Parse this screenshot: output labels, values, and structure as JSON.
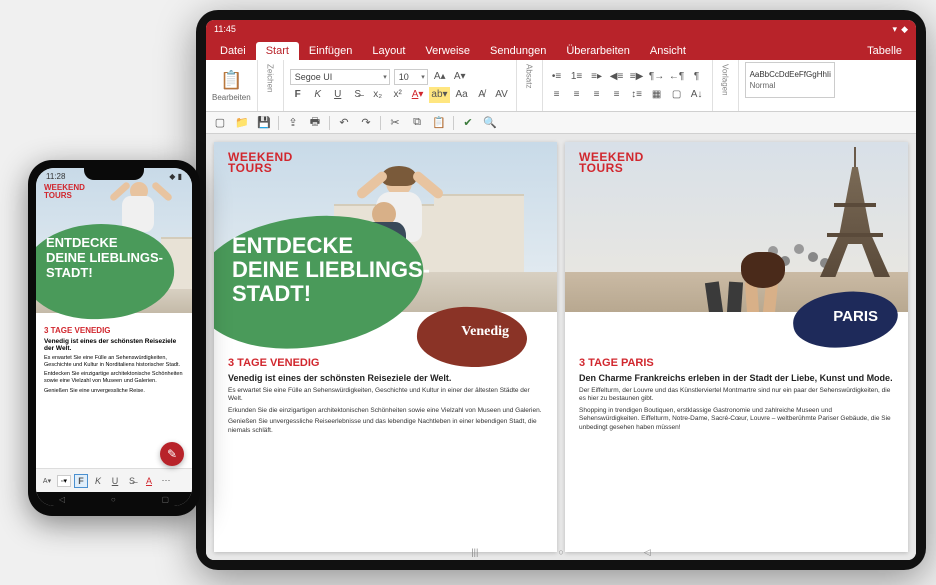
{
  "statusbar": {
    "time": "11:45",
    "phone_time": "11:28"
  },
  "menu": {
    "tabs": [
      "Datei",
      "Start",
      "Einfügen",
      "Layout",
      "Verweise",
      "Sendungen",
      "Überarbeiten",
      "Ansicht",
      "Tabelle"
    ],
    "active": "Start"
  },
  "ribbon": {
    "edit_label": "Bearbeiten",
    "font_group": "Zeichen",
    "para_group": "Absatz",
    "style_group": "Vorlagen",
    "font_name": "Segoe UI",
    "font_size": "10",
    "style_sample": "AaBbCcDdEeFfGgHhIi",
    "style_name": "Normal"
  },
  "brand": {
    "l1": "WEEKEND",
    "l2": "TOURS"
  },
  "headline": {
    "l1": "ENTDECKE",
    "l2": "DEINE LIEBLINGS-",
    "l3": "STADT!"
  },
  "venice": {
    "badge": "Venedig",
    "title": "3 TAGE VENEDIG",
    "sub": "Venedig ist eines der schönsten Reiseziele der Welt.",
    "p1": "Es erwartet Sie eine Fülle an Sehenswürdigkeiten, Geschichte und Kultur in einer der ältesten Städte der Welt.",
    "p2": "Erkunden Sie die einzigartigen architektonischen Schönheiten sowie eine Vielzahl von Museen und Galerien.",
    "p3": "Genießen Sie unvergessliche Reiseerlebnisse und das lebendige Nachtleben in einer lebendigen Stadt, die niemals schläft."
  },
  "paris": {
    "badge": "PARIS",
    "title": "3 TAGE PARIS",
    "sub": "Den Charme Frankreichs erleben in der Stadt der Liebe, Kunst und Mode.",
    "p1": "Der Eiffelturm, der Louvre und das Künstlerviertel Montmartre sind nur ein paar der Sehenswürdigkeiten, die es hier zu bestaunen gibt.",
    "p2": "Shopping in trendigen Boutiquen, erstklassige Gastronomie und zahlreiche Museen und Sehenswürdigkeiten. Eiffelturm, Notre-Dame, Sacré-Cœur, Louvre – weltberühmte Pariser Gebäude, die Sie unbedingt gesehen haben müssen!"
  },
  "phone_doc": {
    "title": "3 TAGE VENEDIG",
    "sub": "Venedig ist eines der schönsten Reiseziele der Welt.",
    "p1": "Es erwartet Sie eine Fülle an Sehenswürdigkeiten, Geschichte und Kultur in Norditaliens historischer Stadt.",
    "p2": "Entdecken Sie einzigartige architektonische Schönheiten sowie eine Vielzahl von Museen und Galerien.",
    "p3": "Genießen Sie eine unvergessliche Reise."
  },
  "phone_toolbar": {
    "font_abbr": "A",
    "bold": "F",
    "italic": "K",
    "underline": "U"
  }
}
